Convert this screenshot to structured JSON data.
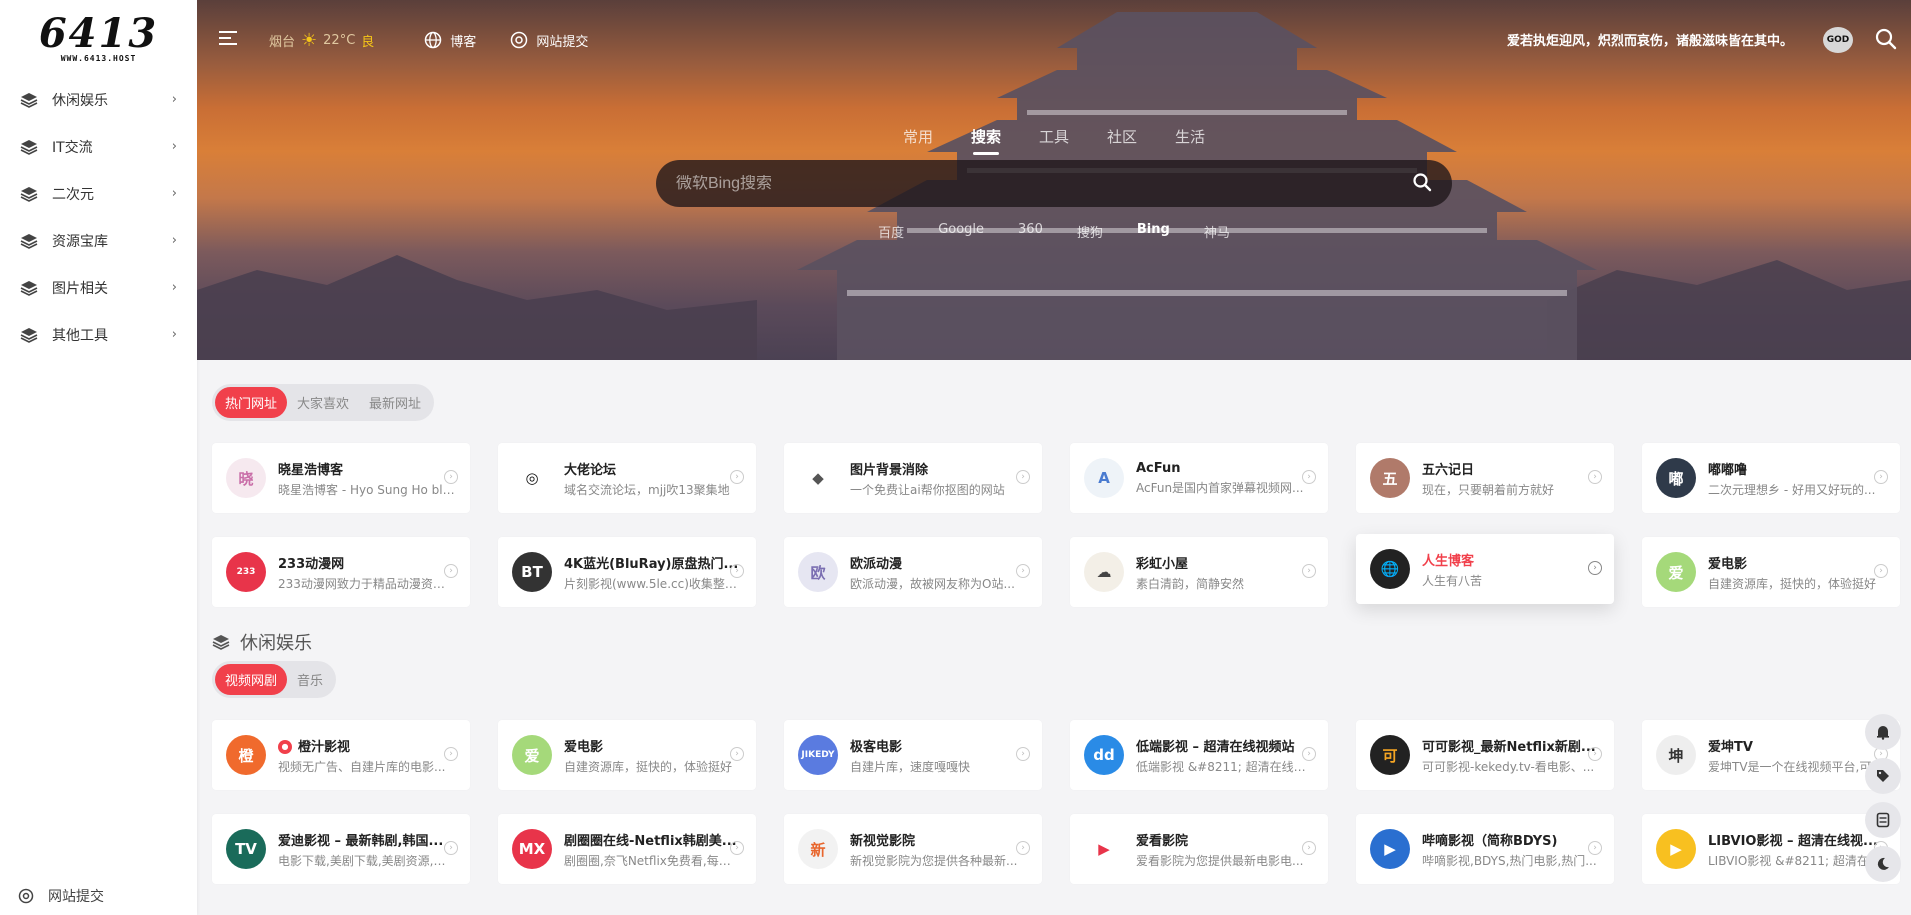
{
  "logo": {
    "main": "6413",
    "sub": "WWW.6413.HOST"
  },
  "sidebar": {
    "items": [
      {
        "label": "休闲娱乐"
      },
      {
        "label": "IT交流"
      },
      {
        "label": "二次元"
      },
      {
        "label": "资源宝库"
      },
      {
        "label": "图片相关"
      },
      {
        "label": "其他工具"
      }
    ],
    "arrow": "›",
    "bottom_label": "网站提交"
  },
  "topbar": {
    "city": "烟台",
    "temp": "22°C",
    "quality": "良",
    "blog": "博客",
    "submit": "网站提交",
    "motto": "爱若执炬迎风，炽烈而哀伤，诸般滋味皆在其中。",
    "avatar": "GOD"
  },
  "search": {
    "tabs": [
      "常用",
      "搜索",
      "工具",
      "社区",
      "生活"
    ],
    "active_tab": 1,
    "placeholder": "微软Bing搜索",
    "engines": [
      "百度",
      "Google",
      "360",
      "搜狗",
      "Bing",
      "神马"
    ],
    "active_engine": 4
  },
  "hot": {
    "pills": [
      "热门网址",
      "大家喜欢",
      "最新网址"
    ],
    "row1": [
      {
        "title": "晓星浩博客",
        "desc": "晓星浩博客 - Hyo Sung Ho blog",
        "icon": "晓",
        "color": "#f6e9ef",
        "fg": "#c96ea8"
      },
      {
        "title": "大佬论坛",
        "desc": "域名交流论坛，mjj吹13聚集地",
        "icon": "◎",
        "color": "#ffffff",
        "fg": "#111111"
      },
      {
        "title": "图片背景消除",
        "desc": "一个免费让ai帮你抠图的网站",
        "icon": "◆",
        "color": "#ffffff",
        "fg": "#555555"
      },
      {
        "title": "AcFun",
        "desc": "AcFun是国内首家弹幕视频网...",
        "icon": "A",
        "color": "#eef3f8",
        "fg": "#4a7bd0"
      },
      {
        "title": "五六记日",
        "desc": "现在，只要朝着前方就好",
        "icon": "五",
        "color": "#b07a6a",
        "fg": "#ffffff"
      },
      {
        "title": "嘟嘟噜",
        "desc": "二次元理想乡 - 好用又好玩的...",
        "icon": "嘟",
        "color": "#2f3a4a",
        "fg": "#ffffff"
      }
    ],
    "row2": [
      {
        "title": "233动漫网",
        "desc": "233动漫网致力于精品动漫资源...",
        "icon": "233",
        "color": "#e8344a",
        "fg": "#ffffff"
      },
      {
        "title": "4K蓝光(BluRay)原盘热门...",
        "desc": "片刻影视(www.5le.cc)收集整理...",
        "icon": "BT",
        "color": "#333333",
        "fg": "#ffffff"
      },
      {
        "title": "欧派动漫",
        "desc": "欧派动漫，故被网友称为O站...",
        "icon": "欧",
        "color": "#e6e6f2",
        "fg": "#7b6fb2"
      },
      {
        "title": "彩虹小屋",
        "desc": "素白清韵，简静安然",
        "icon": "☁",
        "color": "#f3efe7",
        "fg": "#444444"
      },
      {
        "title": "人生博客",
        "desc": "人生有八苦",
        "icon": "🌐",
        "color": "#222222",
        "fg": "#ffffff"
      },
      {
        "title": "爱电影",
        "desc": "自建资源库，挺快的，体验挺好",
        "icon": "爱",
        "color": "#a5d97a",
        "fg": "#ffffff"
      }
    ],
    "hover_index": 4
  },
  "section": {
    "title": "休闲娱乐",
    "pills": [
      "视频网剧",
      "音乐"
    ],
    "row1": [
      {
        "title": "橙汁影视",
        "desc": "视频无广告、自建片库的电影...",
        "icon": "橙",
        "color": "#f06a2d",
        "fg": "#ffffff",
        "hot": true
      },
      {
        "title": "爱电影",
        "desc": "自建资源库，挺快的，体验挺好",
        "icon": "爱",
        "color": "#a5d97a",
        "fg": "#ffffff"
      },
      {
        "title": "极客电影",
        "desc": "自建片库，速度嘎嘎快",
        "icon": "JIKEDY",
        "color": "#5a7be0",
        "fg": "#ffffff"
      },
      {
        "title": "低端影视 – 超清在线视频站",
        "desc": "低端影视 &#8211; 超清在线视...",
        "icon": "dd",
        "color": "#2a8be6",
        "fg": "#ffffff"
      },
      {
        "title": "可可影视_最新Netflix新剧...",
        "desc": "可可影视-kekedy.tv-看电影、...",
        "icon": "可",
        "color": "#222222",
        "fg": "#f6a623"
      },
      {
        "title": "爱坤TV",
        "desc": "爱坤TV是一个在线视频平台,可...",
        "icon": "坤",
        "color": "#eeeeee",
        "fg": "#333333"
      }
    ],
    "row2": [
      {
        "title": "爱迪影视 – 最新韩剧,韩国...",
        "desc": "电影下载,美剧下载,美剧资源,韩...",
        "icon": "TV",
        "color": "#1a6b5a",
        "fg": "#ffffff"
      },
      {
        "title": "剧圈圈在线-Netflix韩剧美...",
        "desc": "剧圈圈,奈飞Netflix免费看,每天...",
        "icon": "MX",
        "color": "#e8344a",
        "fg": "#ffffff"
      },
      {
        "title": "新视觉影院",
        "desc": "新视觉影院为您提供各种最新...",
        "icon": "新",
        "color": "#f2f2f2",
        "fg": "#e8662d"
      },
      {
        "title": "爱看影院",
        "desc": "爱看影院为您提供最新电影电...",
        "icon": "▶",
        "color": "#ffffff",
        "fg": "#e8344a"
      },
      {
        "title": "哔嘀影视（简称BDYS)",
        "desc": "哔嘀影视,BDYS,热门电影,热门...",
        "icon": "▶",
        "color": "#2a6fd0",
        "fg": "#ffffff"
      },
      {
        "title": "LIBVIO影视 – 超清在线视...",
        "desc": "LIBVIO影视 &#8211; 超清在线视...",
        "icon": "▶",
        "color": "#f8c020",
        "fg": "#ffffff"
      }
    ]
  },
  "colors": {
    "accent": "#f1404b",
    "sidebar_bg": "#ffffff",
    "page_bg": "#f4f4f6"
  }
}
